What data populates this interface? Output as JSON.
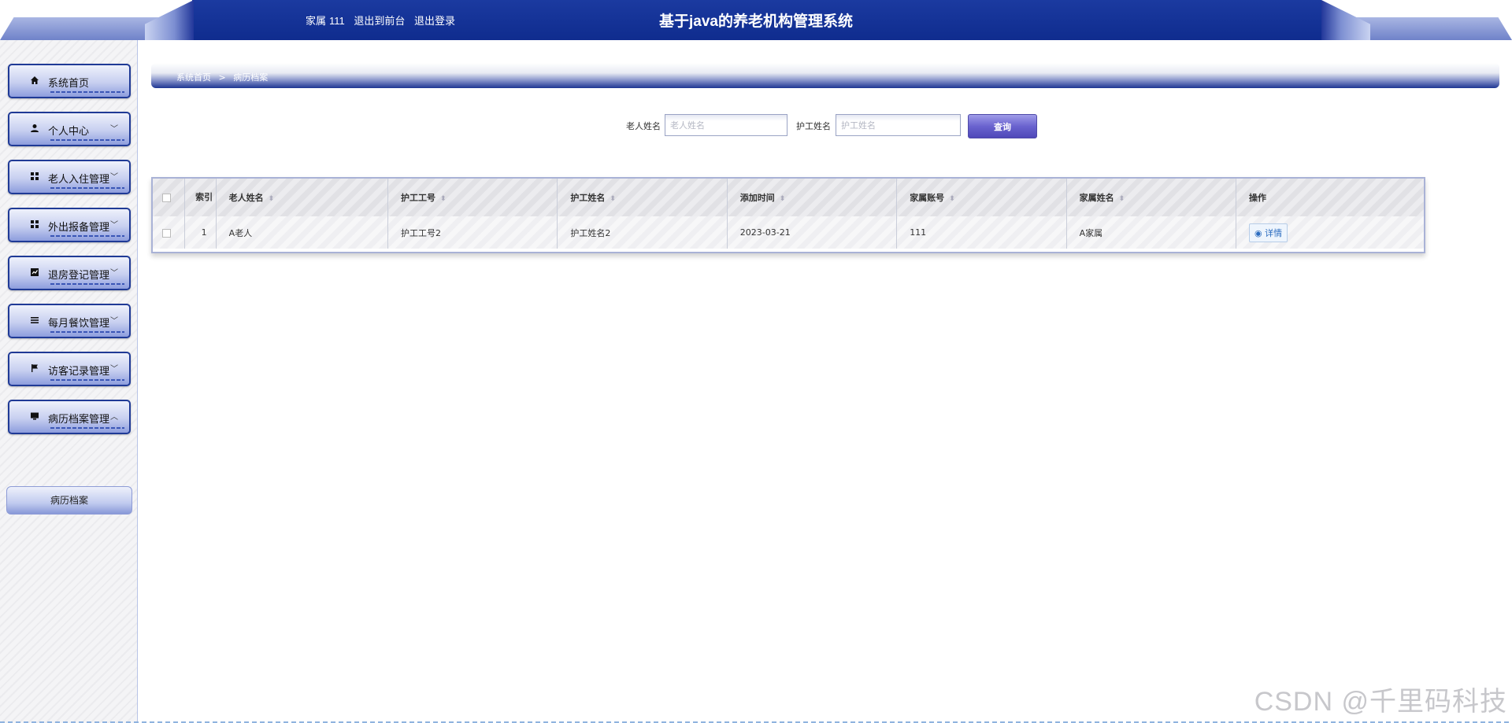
{
  "header": {
    "title": "基于java的养老机构管理系统",
    "role": "家属",
    "username": "111",
    "to_front_label": "退出到前台",
    "logout_label": "退出登录"
  },
  "sidebar": {
    "items": [
      {
        "label": "系统首页",
        "icon": "home-icon",
        "expandable": false
      },
      {
        "label": "个人中心",
        "icon": "user-icon",
        "expandable": true,
        "expanded": false
      },
      {
        "label": "老人入住管理",
        "icon": "grid-icon",
        "expandable": true,
        "expanded": false
      },
      {
        "label": "外出报备管理",
        "icon": "grid-icon",
        "expandable": true,
        "expanded": false
      },
      {
        "label": "退房登记管理",
        "icon": "chart-icon",
        "expandable": true,
        "expanded": false
      },
      {
        "label": "每月餐饮管理",
        "icon": "list-icon",
        "expandable": true,
        "expanded": false
      },
      {
        "label": "访客记录管理",
        "icon": "flag-icon",
        "expandable": true,
        "expanded": false
      },
      {
        "label": "病历档案管理",
        "icon": "monitor-icon",
        "expandable": true,
        "expanded": true
      }
    ],
    "submenu": {
      "label": "病历档案"
    }
  },
  "breadcrumb": {
    "home": "系统首页",
    "separator": ">",
    "current": "病历档案"
  },
  "search": {
    "elder_name_label": "老人姓名",
    "elder_name_placeholder": "老人姓名",
    "elder_name_value": "",
    "nurse_name_label": "护工姓名",
    "nurse_name_placeholder": "护工姓名",
    "nurse_name_value": "",
    "query_label": "查询"
  },
  "table": {
    "headers": {
      "index": "索引",
      "elder_name": "老人姓名",
      "nurse_id": "护工工号",
      "nurse_name": "护工姓名",
      "added_time": "添加时间",
      "family_account": "家属账号",
      "family_name": "家属姓名",
      "action": "操作"
    },
    "rows": [
      {
        "index": "1",
        "elder_name": "A老人",
        "nurse_id": "护工工号2",
        "nurse_name": "护工姓名2",
        "added_time": "2023-03-21",
        "family_account": "111",
        "family_name": "A家属",
        "detail_label": "详情"
      }
    ]
  },
  "watermark": "CSDN @千里码科技",
  "colors": {
    "header_blue": "#0f2c8e",
    "menu_border": "#1f3a96",
    "query_button": "#6a63cf",
    "detail_link": "#2a6bbf"
  }
}
